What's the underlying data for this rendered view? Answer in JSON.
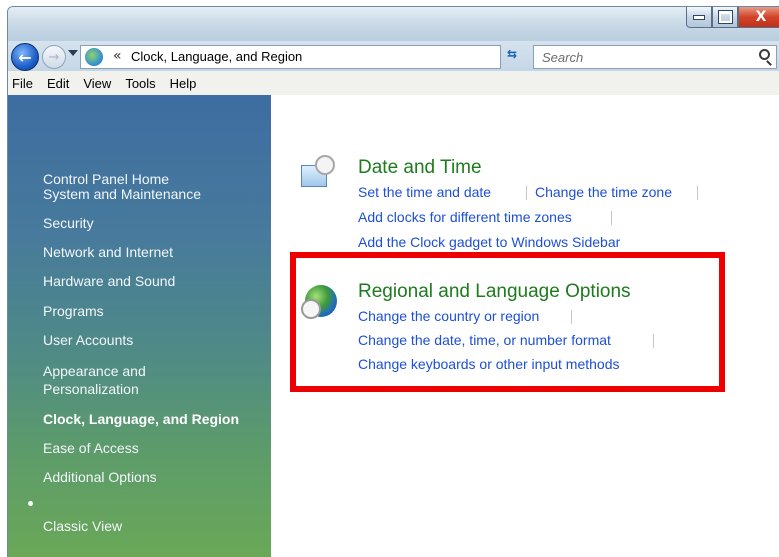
{
  "window": {
    "caption_close": "X"
  },
  "address_bar": {
    "back_glyph": "←",
    "forward_glyph": "→",
    "separator": "«",
    "location": "Clock, Language, and Region",
    "search_placeholder": "Search"
  },
  "menu": {
    "items": [
      "File",
      "Edit",
      "View",
      "Tools",
      "Help"
    ]
  },
  "sidebar": {
    "home": "Control Panel Home",
    "items": [
      "System and Maintenance",
      "Security",
      "Network and Internet",
      "Hardware and Sound",
      "Programs",
      "User Accounts",
      "Appearance and",
      "Personalization",
      "Clock, Language, and Region",
      "Ease of Access",
      "Additional Options"
    ],
    "classic_view": "Classic View"
  },
  "content": {
    "date_time": {
      "title": "Date and Time",
      "links": [
        "Set the time and date",
        "Change the time zone",
        "Add clocks for different time zones",
        "Add the Clock gadget to Windows Sidebar"
      ]
    },
    "regional": {
      "title": "Regional and Language Options",
      "links": [
        "Change the country or region",
        "Change the date, time, or number format",
        "Change keyboards or other input methods"
      ]
    }
  },
  "annotation": {
    "highlight_color": "#ee0000"
  },
  "colors": {
    "category_title": "#1e7b1e",
    "link": "#1d4fd8"
  }
}
